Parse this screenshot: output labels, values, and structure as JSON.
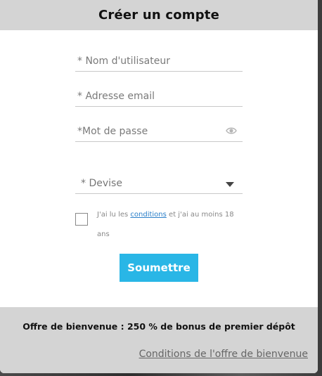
{
  "modal": {
    "title": "Créer un compte"
  },
  "form": {
    "username_placeholder": "* Nom d'utilisateur",
    "email_placeholder": "* Adresse email",
    "password_placeholder": "*Mot de passe",
    "currency_label": "* Devise",
    "terms_prefix": "J'ai lu les ",
    "terms_link": "conditions",
    "terms_suffix": " et j'ai au moins 18 ans",
    "submit_label": "Soumettre",
    "checkbox_checked": false
  },
  "footer": {
    "offer_text": "Offre de bienvenue : 250 % de bonus de premier dépôt",
    "offer_link": "Conditions de l'offre de bienvenue"
  },
  "colors": {
    "accent": "#29b6e6",
    "header_bg": "#d4d4d4",
    "link": "#2a7fc9"
  },
  "icons": {
    "password_toggle": "eye-icon",
    "currency_dropdown": "caret-down-icon"
  }
}
